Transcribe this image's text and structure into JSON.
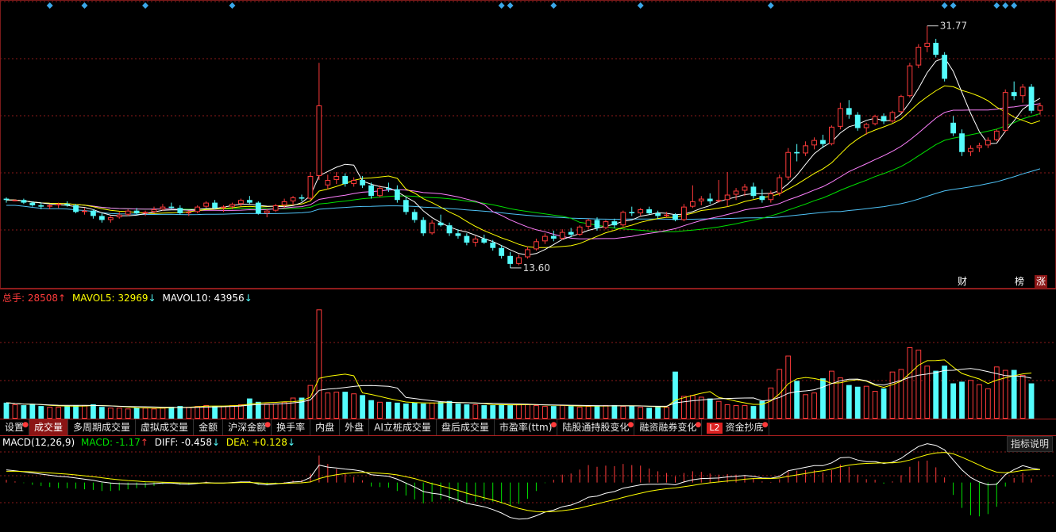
{
  "candle_legend": {
    "hi_label": "31.77",
    "lo_label": "13.60"
  },
  "vol_legend": {
    "total_label": "总手: ",
    "total_value": "28508",
    "total_arrow": "↑",
    "ma5_label": "MAVOL5: ",
    "ma5_value": "32969",
    "ma5_arrow": "↓",
    "ma10_label": "MAVOL10: ",
    "ma10_value": "43956",
    "ma10_arrow": "↓"
  },
  "macd_legend": {
    "name": "MACD(12,26,9)",
    "macd_label": "MACD: ",
    "macd_value": "-1.17",
    "macd_arrow": "↑",
    "diff_label": "DIFF: ",
    "diff_value": "-0.458",
    "diff_arrow": "↓",
    "dea_label": "DEA: ",
    "dea_value": "+0.128",
    "dea_arrow": "↓"
  },
  "help_button": "指标说明",
  "tabs": [
    {
      "label": "设置",
      "dot": true,
      "active": false
    },
    {
      "label": "成交量",
      "dot": false,
      "active": true
    },
    {
      "label": "多周期成交量",
      "dot": false,
      "active": false
    },
    {
      "label": "虚拟成交量",
      "dot": false,
      "active": false
    },
    {
      "label": "金额",
      "dot": false,
      "active": false
    },
    {
      "label": "沪深金额",
      "dot": true,
      "active": false
    },
    {
      "label": "换手率",
      "dot": false,
      "active": false
    },
    {
      "label": "内盘",
      "dot": false,
      "active": false
    },
    {
      "label": "外盘",
      "dot": false,
      "active": false
    },
    {
      "label": "AI立桩成交量",
      "dot": false,
      "active": false
    },
    {
      "label": "盘后成交量",
      "dot": false,
      "active": false
    },
    {
      "label": "市盈率(ttm)",
      "dot": true,
      "active": false
    },
    {
      "label": "陆股通持股变化",
      "dot": true,
      "active": false
    },
    {
      "label": "融资融券变化",
      "dot": true,
      "active": false
    },
    {
      "label": "资金抄底",
      "dot": true,
      "active": false,
      "badge": "L2"
    }
  ],
  "signs": [
    {
      "label": "财",
      "bg": "#000000",
      "pos": 1204
    },
    {
      "label": "榜",
      "bg": "#000000",
      "pos": 1276
    },
    {
      "label": "涨",
      "bg": "#8b1515",
      "pos": 1303
    }
  ],
  "colors": {
    "up": "#ff3b3b",
    "down": "#54fcfc",
    "ma5": "#ffffff",
    "ma10": "#ffff00",
    "ma20": "#ff80ff",
    "ma30": "#00e000",
    "ma60": "#4fc3f7",
    "diff": "#ffffff",
    "dea": "#ffff00",
    "grid": "#8b1a1a"
  },
  "chart_data": {
    "type": "candlestick",
    "price_range": [
      13.0,
      33.0
    ],
    "high": 31.77,
    "low": 13.6,
    "ohlc": [
      [
        18.8,
        18.9,
        18.5,
        18.7
      ],
      [
        18.7,
        18.75,
        18.6,
        18.7
      ],
      [
        18.7,
        18.8,
        18.4,
        18.5
      ],
      [
        18.5,
        18.6,
        18.2,
        18.3
      ],
      [
        18.3,
        18.5,
        18.0,
        18.2
      ],
      [
        18.2,
        18.4,
        18.0,
        18.3
      ],
      [
        18.3,
        18.5,
        18.1,
        18.4
      ],
      [
        18.4,
        18.6,
        18.2,
        18.3
      ],
      [
        18.3,
        18.4,
        17.7,
        17.8
      ],
      [
        17.8,
        18.1,
        17.6,
        17.9
      ],
      [
        17.9,
        18.0,
        17.3,
        17.5
      ],
      [
        17.5,
        17.7,
        17.0,
        17.2
      ],
      [
        17.2,
        17.5,
        17.0,
        17.4
      ],
      [
        17.4,
        17.8,
        17.3,
        17.6
      ],
      [
        17.6,
        18.0,
        17.5,
        17.9
      ],
      [
        17.9,
        18.1,
        17.6,
        17.7
      ],
      [
        17.7,
        17.9,
        17.5,
        17.8
      ],
      [
        17.8,
        18.2,
        17.7,
        18.0
      ],
      [
        18.0,
        18.4,
        17.9,
        18.2
      ],
      [
        18.2,
        18.5,
        18.0,
        18.1
      ],
      [
        18.1,
        18.3,
        17.6,
        17.7
      ],
      [
        17.7,
        17.9,
        17.5,
        17.8
      ],
      [
        17.8,
        18.3,
        17.7,
        18.2
      ],
      [
        18.2,
        18.6,
        18.1,
        18.5
      ],
      [
        18.5,
        18.7,
        18.0,
        18.1
      ],
      [
        18.1,
        18.3,
        17.8,
        18.2
      ],
      [
        18.2,
        18.5,
        18.0,
        18.4
      ],
      [
        18.4,
        18.8,
        18.2,
        18.7
      ],
      [
        18.7,
        19.0,
        18.4,
        18.5
      ],
      [
        18.5,
        18.6,
        17.6,
        17.7
      ],
      [
        17.7,
        18.0,
        17.4,
        17.9
      ],
      [
        17.9,
        18.4,
        17.8,
        18.3
      ],
      [
        18.3,
        18.8,
        18.1,
        18.6
      ],
      [
        18.6,
        19.0,
        18.3,
        18.9
      ],
      [
        18.9,
        19.1,
        18.6,
        18.8
      ],
      [
        18.8,
        20.8,
        18.7,
        20.5
      ],
      [
        20.5,
        29.0,
        20.2,
        25.8
      ],
      [
        19.8,
        20.6,
        19.5,
        20.2
      ],
      [
        20.2,
        20.8,
        19.9,
        20.5
      ],
      [
        20.5,
        20.7,
        19.7,
        19.9
      ],
      [
        19.9,
        20.4,
        19.7,
        20.2
      ],
      [
        20.2,
        20.5,
        19.6,
        19.8
      ],
      [
        19.8,
        20.0,
        18.8,
        19.0
      ],
      [
        19.0,
        19.8,
        18.9,
        19.6
      ],
      [
        19.6,
        20.0,
        19.3,
        19.5
      ],
      [
        19.5,
        19.8,
        18.5,
        18.7
      ],
      [
        18.7,
        18.9,
        17.6,
        17.8
      ],
      [
        17.8,
        18.0,
        17.0,
        17.2
      ],
      [
        17.2,
        17.4,
        16.0,
        16.2
      ],
      [
        16.2,
        17.2,
        16.1,
        17.0
      ],
      [
        17.0,
        17.6,
        16.7,
        16.8
      ],
      [
        16.8,
        17.0,
        16.0,
        16.2
      ],
      [
        16.2,
        16.5,
        15.8,
        16.0
      ],
      [
        16.0,
        16.2,
        15.3,
        15.5
      ],
      [
        15.5,
        16.0,
        15.2,
        15.8
      ],
      [
        15.8,
        16.1,
        15.4,
        15.5
      ],
      [
        15.5,
        15.7,
        14.9,
        15.1
      ],
      [
        15.1,
        15.3,
        14.3,
        14.5
      ],
      [
        14.5,
        14.8,
        13.6,
        13.9
      ],
      [
        13.9,
        14.6,
        13.8,
        14.4
      ],
      [
        14.4,
        15.2,
        14.3,
        15.0
      ],
      [
        15.0,
        15.8,
        14.9,
        15.6
      ],
      [
        15.6,
        16.2,
        15.4,
        16.0
      ],
      [
        16.0,
        16.4,
        15.6,
        15.8
      ],
      [
        15.8,
        16.5,
        15.7,
        16.3
      ],
      [
        16.3,
        16.6,
        15.9,
        16.1
      ],
      [
        16.1,
        16.8,
        16.0,
        16.7
      ],
      [
        16.7,
        17.3,
        16.5,
        17.2
      ],
      [
        17.2,
        17.4,
        16.4,
        16.6
      ],
      [
        16.6,
        17.2,
        16.5,
        17.1
      ],
      [
        17.1,
        17.3,
        16.6,
        16.8
      ],
      [
        16.8,
        17.9,
        16.7,
        17.8
      ],
      [
        17.8,
        18.2,
        17.5,
        17.7
      ],
      [
        17.7,
        18.1,
        17.5,
        18.0
      ],
      [
        18.0,
        18.2,
        17.6,
        17.7
      ],
      [
        17.7,
        17.9,
        17.3,
        17.5
      ],
      [
        17.5,
        17.8,
        17.4,
        17.6
      ],
      [
        17.6,
        17.7,
        17.1,
        17.2
      ],
      [
        17.2,
        18.4,
        17.1,
        18.2
      ],
      [
        18.2,
        19.8,
        18.1,
        18.6
      ],
      [
        18.6,
        19.0,
        18.3,
        18.8
      ],
      [
        18.8,
        19.2,
        18.4,
        18.6
      ],
      [
        18.6,
        20.2,
        18.5,
        18.7
      ],
      [
        18.7,
        20.8,
        18.2,
        19.1
      ],
      [
        19.1,
        19.6,
        18.7,
        19.4
      ],
      [
        19.4,
        19.9,
        19.0,
        19.7
      ],
      [
        19.7,
        20.0,
        18.8,
        19.0
      ],
      [
        19.0,
        19.5,
        18.5,
        18.7
      ],
      [
        18.7,
        19.4,
        18.5,
        19.2
      ],
      [
        19.2,
        20.6,
        19.0,
        20.4
      ],
      [
        20.4,
        22.6,
        20.2,
        22.3
      ],
      [
        22.3,
        22.9,
        21.6,
        22.2
      ],
      [
        22.2,
        23.1,
        22.0,
        22.8
      ],
      [
        22.8,
        23.4,
        22.5,
        23.2
      ],
      [
        23.2,
        23.6,
        22.6,
        22.9
      ],
      [
        22.9,
        24.3,
        22.8,
        24.2
      ],
      [
        24.2,
        26.0,
        24.0,
        25.6
      ],
      [
        25.6,
        26.2,
        24.8,
        25.1
      ],
      [
        25.1,
        25.3,
        23.9,
        24.1
      ],
      [
        24.1,
        24.5,
        23.6,
        24.4
      ],
      [
        24.4,
        25.1,
        24.3,
        25.0
      ],
      [
        25.0,
        25.2,
        24.4,
        24.6
      ],
      [
        24.6,
        25.4,
        24.5,
        25.3
      ],
      [
        25.3,
        26.6,
        25.2,
        26.5
      ],
      [
        26.5,
        29.0,
        26.4,
        28.8
      ],
      [
        28.8,
        30.4,
        28.6,
        30.2
      ],
      [
        30.2,
        31.77,
        29.8,
        30.5
      ],
      [
        30.5,
        30.8,
        29.4,
        29.6
      ],
      [
        29.6,
        29.8,
        27.6,
        27.8
      ],
      [
        24.5,
        25.0,
        23.5,
        23.7
      ],
      [
        23.7,
        24.0,
        22.0,
        22.3
      ],
      [
        22.3,
        22.8,
        22.0,
        22.6
      ],
      [
        22.6,
        23.0,
        22.3,
        22.8
      ],
      [
        22.8,
        23.4,
        22.6,
        23.2
      ],
      [
        23.2,
        24.0,
        23.1,
        23.9
      ],
      [
        23.9,
        27.0,
        23.8,
        26.8
      ],
      [
        26.8,
        27.6,
        26.2,
        26.5
      ],
      [
        26.5,
        27.4,
        26.0,
        27.2
      ],
      [
        27.2,
        27.4,
        25.2,
        25.4
      ],
      [
        25.4,
        26.0,
        25.1,
        25.8
      ]
    ],
    "vol_range": [
      0,
      135000
    ],
    "volume": [
      19000,
      17000,
      16000,
      17000,
      15000,
      14000,
      14000,
      15000,
      16000,
      16000,
      17000,
      14000,
      13000,
      13000,
      12000,
      13000,
      13000,
      12000,
      13000,
      14000,
      15000,
      14000,
      15000,
      16000,
      15000,
      15000,
      16000,
      17000,
      24000,
      20000,
      18000,
      18000,
      20000,
      25000,
      25000,
      40000,
      130000,
      31000,
      32000,
      32000,
      30000,
      28000,
      22000,
      20000,
      20000,
      19000,
      18000,
      19000,
      18000,
      19000,
      20000,
      21000,
      18000,
      17000,
      17000,
      16000,
      16000,
      17000,
      16000,
      17000,
      17000,
      16000,
      15000,
      15000,
      16000,
      15000,
      14000,
      15000,
      15000,
      16000,
      16000,
      15000,
      15000,
      14000,
      13000,
      14000,
      14000,
      56000,
      27000,
      28000,
      26000,
      24000,
      21000,
      17000,
      16000,
      16000,
      15000,
      21000,
      37000,
      59000,
      75000,
      45000,
      29000,
      31000,
      48000,
      57000,
      49000,
      40000,
      38000,
      39000,
      33000,
      36000,
      56000,
      59000,
      85000,
      82000,
      63000,
      57000,
      63000,
      42000,
      44000,
      46000,
      41000,
      36000,
      62000,
      58000,
      58000,
      52000,
      42000
    ],
    "macd_range": [
      -1.7,
      1.2
    ],
    "diff": [
      0.45,
      0.42,
      0.38,
      0.34,
      0.3,
      0.26,
      0.22,
      0.2,
      0.16,
      0.12,
      0.08,
      0.02,
      -0.02,
      -0.04,
      -0.05,
      -0.05,
      -0.06,
      -0.04,
      -0.02,
      -0.02,
      -0.05,
      -0.06,
      -0.03,
      0.0,
      -0.02,
      -0.02,
      0.0,
      0.02,
      0.02,
      -0.05,
      -0.08,
      -0.05,
      -0.02,
      0.02,
      0.04,
      0.18,
      0.62,
      0.55,
      0.52,
      0.48,
      0.45,
      0.4,
      0.28,
      0.25,
      0.22,
      0.12,
      -0.02,
      -0.16,
      -0.32,
      -0.38,
      -0.42,
      -0.52,
      -0.62,
      -0.74,
      -0.8,
      -0.86,
      -0.96,
      -1.08,
      -1.24,
      -1.3,
      -1.28,
      -1.18,
      -1.05,
      -0.98,
      -0.86,
      -0.8,
      -0.68,
      -0.52,
      -0.48,
      -0.38,
      -0.32,
      -0.2,
      -0.14,
      -0.08,
      -0.06,
      -0.06,
      -0.05,
      -0.08,
      0.02,
      0.1,
      0.14,
      0.15,
      0.16,
      0.2,
      0.22,
      0.25,
      0.22,
      0.16,
      0.15,
      0.22,
      0.42,
      0.48,
      0.54,
      0.6,
      0.6,
      0.7,
      0.88,
      0.9,
      0.8,
      0.74,
      0.74,
      0.68,
      0.72,
      0.86,
      1.08,
      1.28,
      1.38,
      1.32,
      1.16,
      0.8,
      0.45,
      0.18,
      0.02,
      -0.08,
      -0.06,
      0.28,
      0.46,
      0.6,
      0.52,
      0.46
    ],
    "dea": [
      0.4,
      0.4,
      0.39,
      0.38,
      0.36,
      0.34,
      0.32,
      0.3,
      0.27,
      0.24,
      0.21,
      0.17,
      0.13,
      0.1,
      0.07,
      0.05,
      0.03,
      0.02,
      0.01,
      0.0,
      -0.01,
      -0.02,
      -0.02,
      -0.02,
      -0.02,
      -0.02,
      -0.01,
      0.0,
      0.0,
      -0.01,
      -0.03,
      -0.03,
      -0.03,
      -0.02,
      -0.01,
      0.02,
      0.14,
      0.22,
      0.28,
      0.32,
      0.35,
      0.36,
      0.35,
      0.33,
      0.31,
      0.27,
      0.21,
      0.14,
      0.05,
      -0.04,
      -0.12,
      -0.2,
      -0.28,
      -0.38,
      -0.46,
      -0.54,
      -0.62,
      -0.71,
      -0.82,
      -0.92,
      -0.99,
      -1.03,
      -1.04,
      -1.03,
      -1.0,
      -0.96,
      -0.91,
      -0.83,
      -0.76,
      -0.68,
      -0.61,
      -0.53,
      -0.45,
      -0.38,
      -0.31,
      -0.26,
      -0.22,
      -0.19,
      -0.15,
      -0.1,
      -0.05,
      -0.01,
      0.02,
      0.05,
      0.08,
      0.12,
      0.14,
      0.14,
      0.14,
      0.16,
      0.22,
      0.27,
      0.32,
      0.38,
      0.42,
      0.48,
      0.56,
      0.62,
      0.66,
      0.68,
      0.69,
      0.7,
      0.7,
      0.73,
      0.8,
      0.9,
      0.99,
      1.05,
      1.07,
      1.02,
      0.9,
      0.76,
      0.62,
      0.48,
      0.37,
      0.35,
      0.38,
      0.43,
      0.45,
      0.46
    ]
  }
}
